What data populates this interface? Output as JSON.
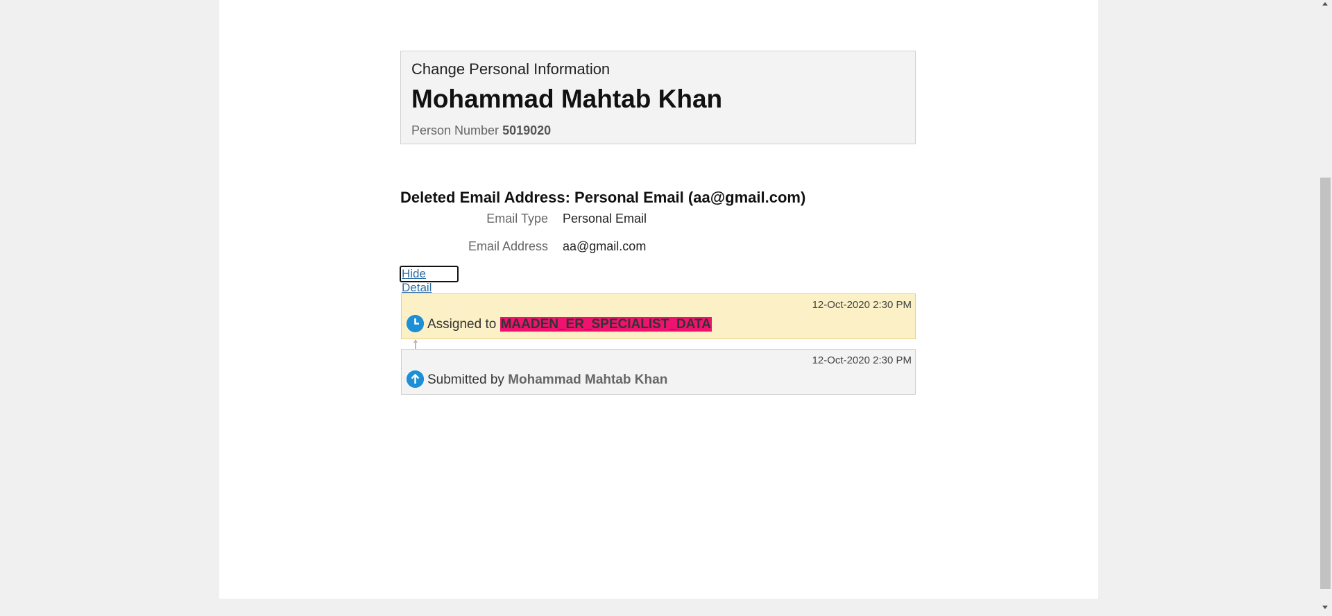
{
  "header": {
    "subtitle": "Change Personal Information",
    "name": "Mohammad Mahtab Khan",
    "person_number_label": "Person Number",
    "person_number": "5019020"
  },
  "section": {
    "title": "Deleted Email Address: Personal Email (aa@gmail.com)",
    "fields": [
      {
        "label": "Email Type",
        "value": "Personal Email"
      },
      {
        "label": "Email Address",
        "value": "aa@gmail.com"
      }
    ],
    "hide_detail_label": "Hide Detail"
  },
  "history": [
    {
      "timestamp": "12-Oct-2020 2:30 PM",
      "action": "Assigned to",
      "target": "MAADEN_ER_SPECIALIST_DATA",
      "icon": "clock-icon",
      "status_color": "#fbf0c6"
    },
    {
      "timestamp": "12-Oct-2020 2:30 PM",
      "action": "Submitted by",
      "target": "Mohammad Mahtab Khan",
      "icon": "upload-arrow-icon",
      "status_color": "#f3f3f3"
    }
  ],
  "colors": {
    "accent": "#1d8fd6",
    "role_highlight": "#f0126f",
    "link": "#2e6da4"
  }
}
